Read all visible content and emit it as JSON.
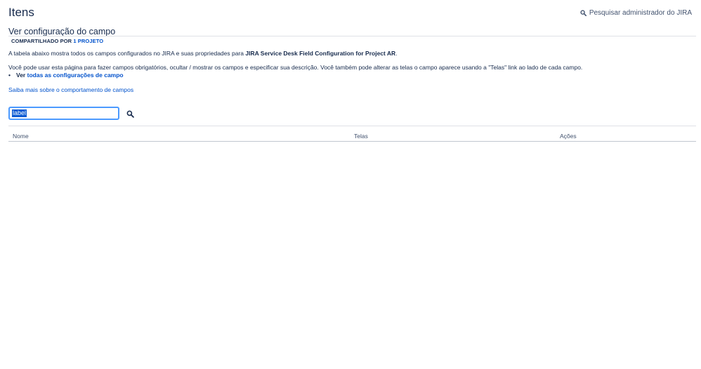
{
  "header": {
    "title": "Itens",
    "admin_search_label": "Pesquisar administrador do JIRA"
  },
  "section": {
    "title": "Ver configuração do campo",
    "shared_by": "COMPARTILHADO POR",
    "shared_link": "1 PROJETO"
  },
  "description": {
    "line1_prefix": "A tabela abaixo mostra todos os campos configurados no JIRA e suas propriedades para",
    "line1_bold": "JIRA Service Desk Field Configuration for Project AR",
    "line1_suffix": ".",
    "line2": "Você pode usar esta página para fazer campos obrigatórios, ocultar / mostrar os campos e especificar sua descrição. Você também pode alterar as telas o campo aparece usando a \"Telas\" link ao lado de cada campo.",
    "bullet_prefix": "Ver",
    "bullet_link": "todas as configurações de campo",
    "learn_more": "Saiba mais sobre o comportamento de campos"
  },
  "search": {
    "value": "label",
    "icon": "search-icon"
  },
  "table": {
    "headers": [
      "Nome",
      "Telas",
      "Ações"
    ]
  },
  "colors": {
    "link": "#0052cc",
    "text": "#172b4d",
    "focus": "#4c9aff"
  }
}
